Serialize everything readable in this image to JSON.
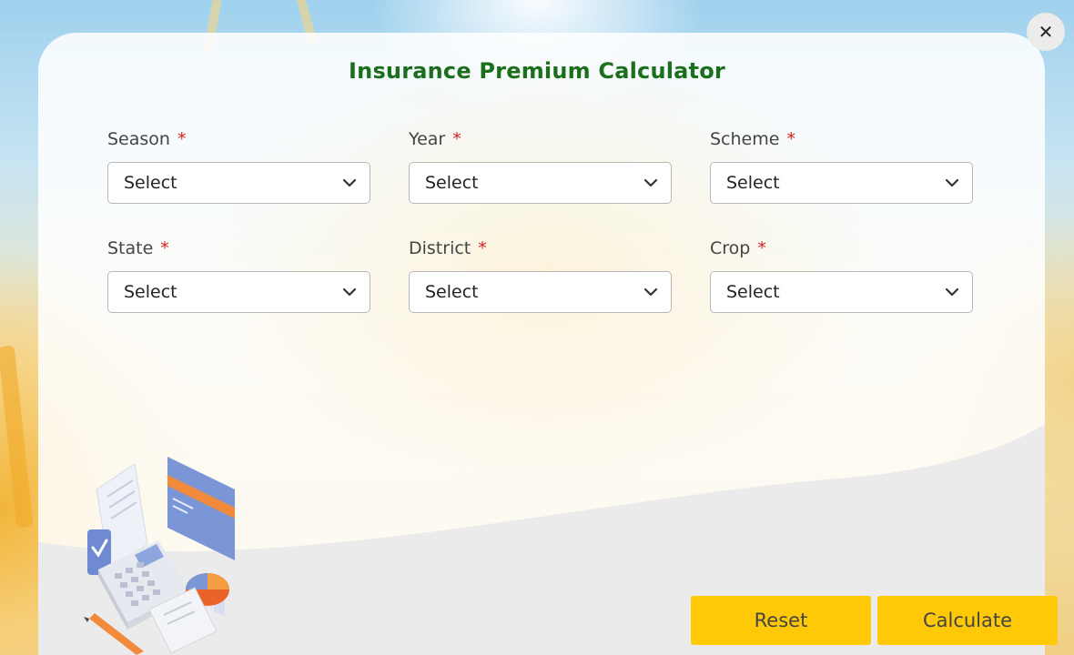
{
  "modal": {
    "title": "Insurance Premium Calculator",
    "close_icon": "close-icon",
    "required_marker": "*"
  },
  "fields": [
    {
      "label": "Season",
      "value": "Select"
    },
    {
      "label": "Year",
      "value": "Select"
    },
    {
      "label": "Scheme",
      "value": "Select"
    },
    {
      "label": "State",
      "value": "Select"
    },
    {
      "label": "District",
      "value": "Select"
    },
    {
      "label": "Crop",
      "value": "Select"
    }
  ],
  "actions": {
    "reset_label": "Reset",
    "calculate_label": "Calculate"
  },
  "colors": {
    "title": "#1b6e1b",
    "required": "#d32222",
    "button": "#ffc907"
  }
}
